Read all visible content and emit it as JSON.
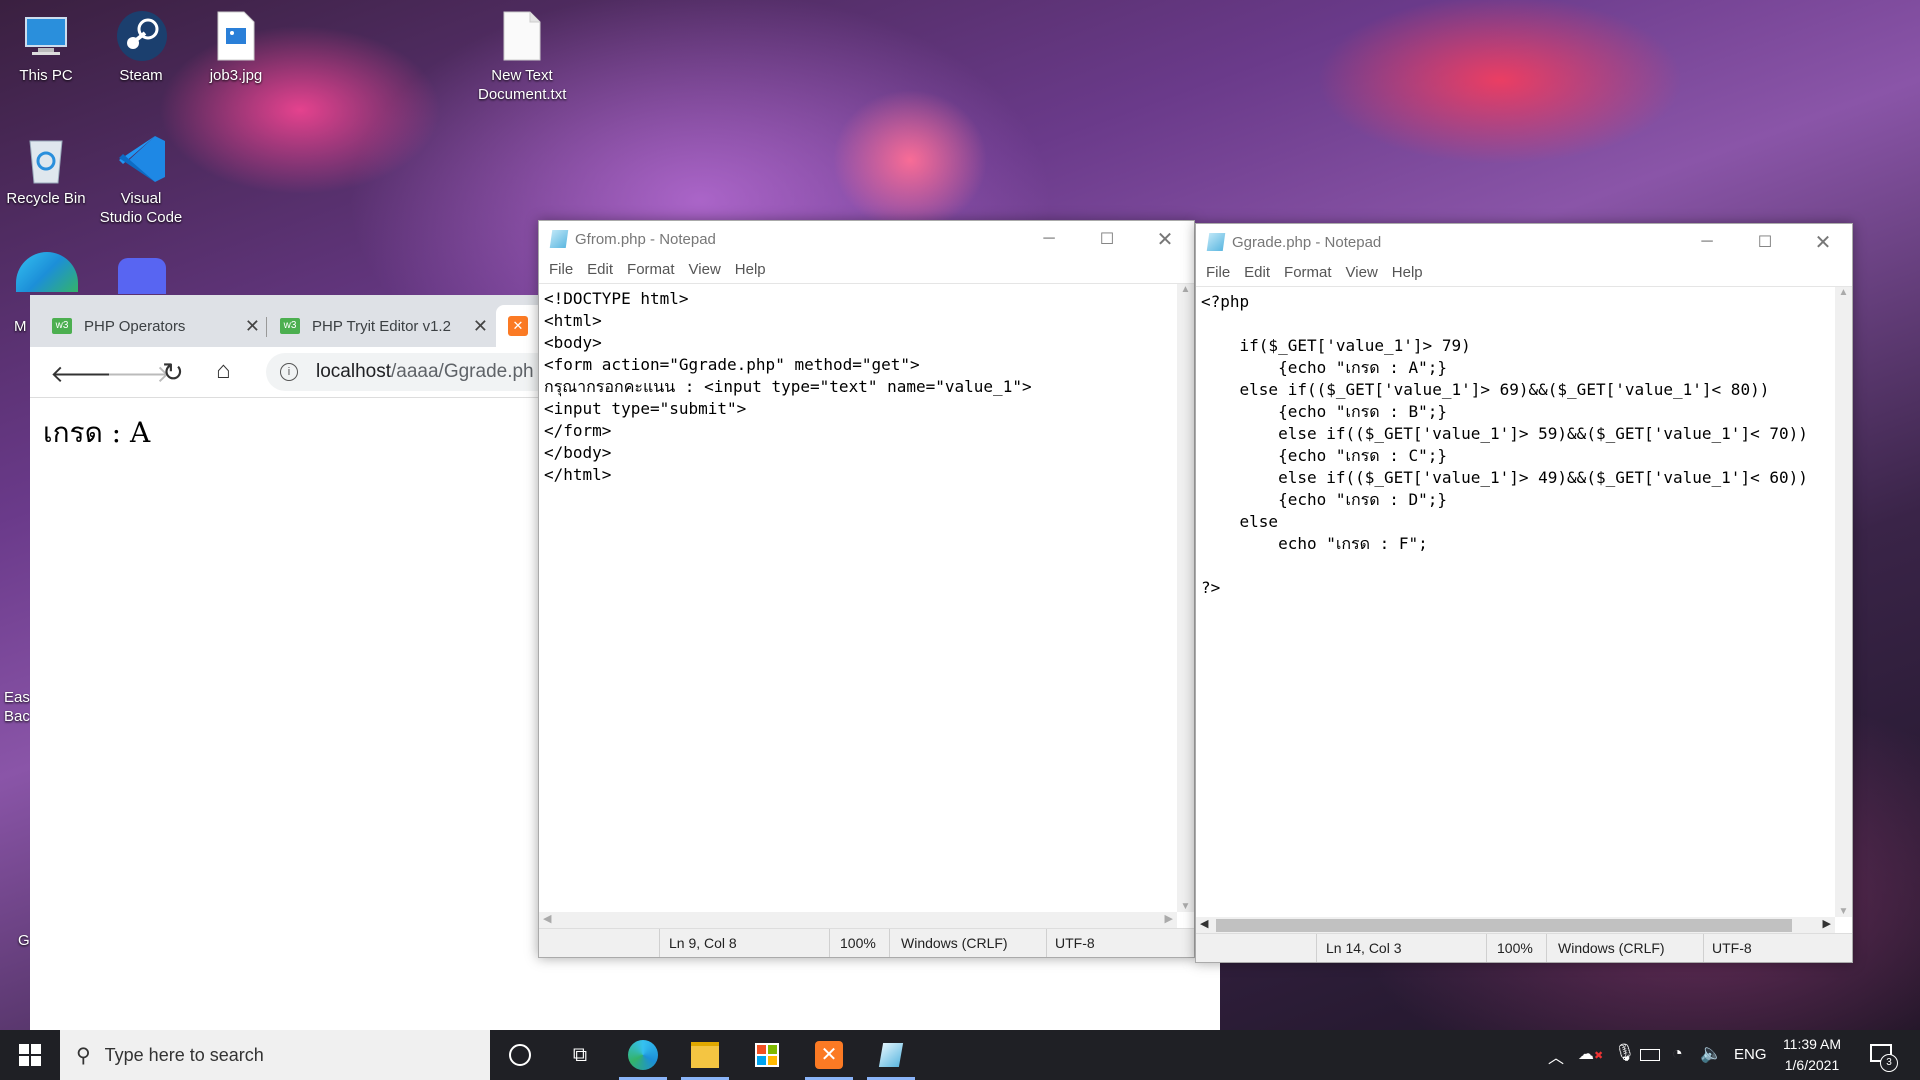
{
  "desktop": {
    "icons": [
      {
        "label": "This PC"
      },
      {
        "label": "Steam"
      },
      {
        "label": "job3.jpg"
      },
      {
        "label": "New Text Document.txt"
      },
      {
        "label": "Recycle Bin"
      },
      {
        "label": "Visual Studio Code"
      }
    ],
    "partial_labels": [
      "M",
      "Ease Bac",
      "G"
    ]
  },
  "browser": {
    "tabs": [
      {
        "label": "PHP Operators"
      },
      {
        "label": "PHP Tryit Editor v1.2"
      }
    ],
    "url_host": "localhost",
    "url_path": "/aaaa/Ggrade.ph",
    "page_text": "เกรด : A"
  },
  "notepad_left": {
    "title": "Gfrom.php - Notepad",
    "menu": [
      "File",
      "Edit",
      "Format",
      "View",
      "Help"
    ],
    "code": "<!DOCTYPE html>\n<html>\n<body>\n<form action=\"Ggrade.php\" method=\"get\">\nกรุณากรอกคะแนน : <input type=\"text\" name=\"value_1\">\n<input type=\"submit\">\n</form>\n</body>\n</html>",
    "status": {
      "position": "Ln 9, Col 8",
      "zoom": "100%",
      "line_ending": "Windows (CRLF)",
      "encoding": "UTF-8"
    }
  },
  "notepad_right": {
    "title": "Ggrade.php - Notepad",
    "menu": [
      "File",
      "Edit",
      "Format",
      "View",
      "Help"
    ],
    "code": "<?php\n\n    if($_GET['value_1']> 79)\n        {echo \"เกรด : A\";}\n    else if(($_GET['value_1']> 69)&&($_GET['value_1']< 80))\n        {echo \"เกรด : B\";}\n        else if(($_GET['value_1']> 59)&&($_GET['value_1']< 70))\n        {echo \"เกรด : C\";}\n        else if(($_GET['value_1']> 49)&&($_GET['value_1']< 60))\n        {echo \"เกรด : D\";}\n    else\n        echo \"เกรด : F\";\n\n?>",
    "status": {
      "position": "Ln 14, Col 3",
      "zoom": "100%",
      "line_ending": "Windows (CRLF)",
      "encoding": "UTF-8"
    }
  },
  "taskbar": {
    "search_placeholder": "Type here to search",
    "language": "ENG",
    "time": "11:39 AM",
    "date": "1/6/2021",
    "notification_count": "3"
  },
  "colors": {
    "taskbar": "#1f2025",
    "accent": "#0078d7",
    "edge": "#1fa0e8",
    "xampp": "#fb7a24",
    "vscode": "#1e88e5"
  }
}
